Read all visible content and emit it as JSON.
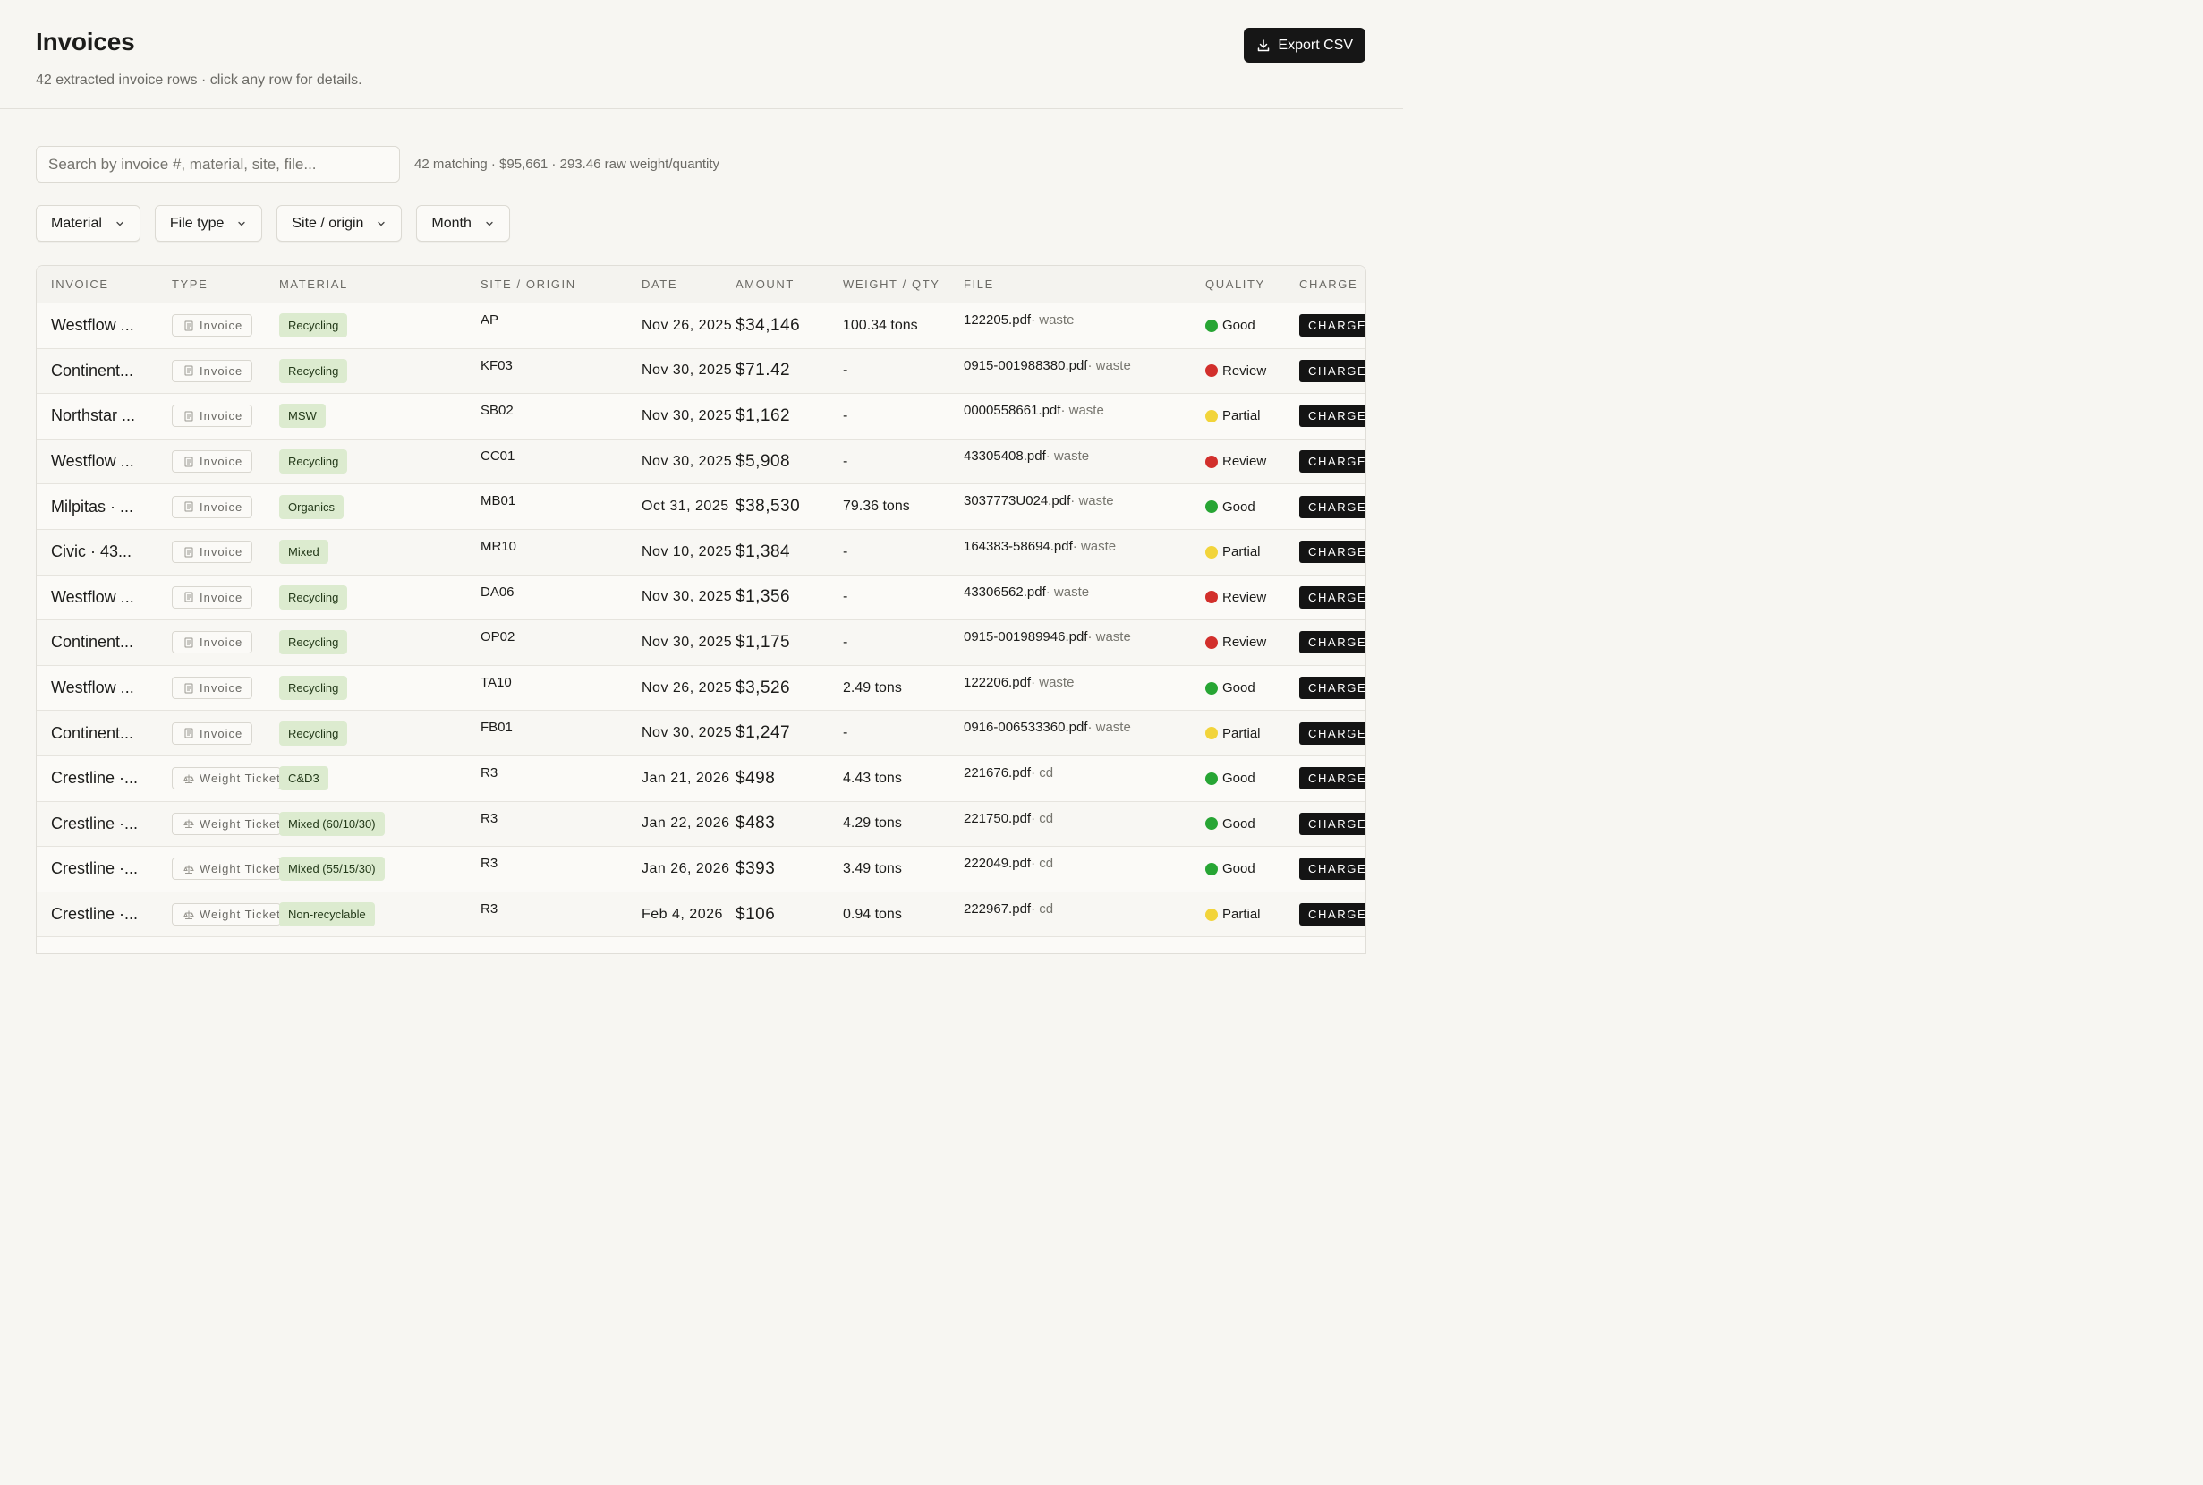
{
  "header": {
    "title": "Invoices",
    "subtitle": "42 extracted invoice rows · click any row for details.",
    "export_label": "Export CSV"
  },
  "search": {
    "placeholder": "Search by invoice #, material, site, file...",
    "summary": "42 matching · $95,661 · 293.46 raw weight/quantity"
  },
  "filters": [
    "Material",
    "File type",
    "Site / origin",
    "Month"
  ],
  "columns": {
    "invoice": "Invoice",
    "type": "Type",
    "material": "Material",
    "site": "Site / origin",
    "date": "Date",
    "amount": "Amount",
    "weight": "Weight / qty",
    "file": "File",
    "quality": "Quality",
    "charge": "Charge"
  },
  "colors": {
    "good": "#27a534",
    "review": "#d22f2b",
    "partial": "#f2d43a",
    "material_bg": "#dcebcf",
    "charge_bg": "#141414"
  },
  "rows": [
    {
      "invoice": "Westflow ...",
      "type": "Invoice",
      "type_icon": "document-icon",
      "material": "Recycling",
      "site": "AP",
      "date": "Nov 26, 2025",
      "amount": "$34,146",
      "weight": "100.34 tons",
      "file": "122205.pdf",
      "file_kind": " · waste",
      "quality": "Good",
      "charge": "CHARGED"
    },
    {
      "invoice": "Continent...",
      "type": "Invoice",
      "type_icon": "document-icon",
      "material": "Recycling",
      "site": "KF03",
      "date": "Nov 30, 2025",
      "amount": "$71.42",
      "weight": "-",
      "file": "0915-001988380.pdf",
      "file_kind": " · waste",
      "quality": "Review",
      "charge": "CHARGED"
    },
    {
      "invoice": "Northstar ...",
      "type": "Invoice",
      "type_icon": "document-icon",
      "material": "MSW",
      "site": "SB02",
      "date": "Nov 30, 2025",
      "amount": "$1,162",
      "weight": "-",
      "file": "0000558661.pdf",
      "file_kind": " · waste",
      "quality": "Partial",
      "charge": "CHARGED"
    },
    {
      "invoice": "Westflow ...",
      "type": "Invoice",
      "type_icon": "document-icon",
      "material": "Recycling",
      "site": "CC01",
      "date": "Nov 30, 2025",
      "amount": "$5,908",
      "weight": "-",
      "file": "43305408.pdf",
      "file_kind": " · waste",
      "quality": "Review",
      "charge": "CHARGED"
    },
    {
      "invoice": "Milpitas · ...",
      "type": "Invoice",
      "type_icon": "document-icon",
      "material": "Organics",
      "site": "MB01",
      "date": "Oct 31, 2025",
      "amount": "$38,530",
      "weight": "79.36 tons",
      "file": "3037773U024.pdf",
      "file_kind": " · waste",
      "quality": "Good",
      "charge": "CHARGED"
    },
    {
      "invoice": "Civic · 43...",
      "type": "Invoice",
      "type_icon": "document-icon",
      "material": "Mixed",
      "site": "MR10",
      "date": "Nov 10, 2025",
      "amount": "$1,384",
      "weight": "-",
      "file": "164383-58694.pdf",
      "file_kind": " · waste",
      "quality": "Partial",
      "charge": "CHARGED"
    },
    {
      "invoice": "Westflow ...",
      "type": "Invoice",
      "type_icon": "document-icon",
      "material": "Recycling",
      "site": "DA06",
      "date": "Nov 30, 2025",
      "amount": "$1,356",
      "weight": "-",
      "file": "43306562.pdf",
      "file_kind": " · waste",
      "quality": "Review",
      "charge": "CHARGED"
    },
    {
      "invoice": "Continent...",
      "type": "Invoice",
      "type_icon": "document-icon",
      "material": "Recycling",
      "site": "OP02",
      "date": "Nov 30, 2025",
      "amount": "$1,175",
      "weight": "-",
      "file": "0915-001989946.pdf",
      "file_kind": " · waste",
      "quality": "Review",
      "charge": "CHARGED"
    },
    {
      "invoice": "Westflow ...",
      "type": "Invoice",
      "type_icon": "document-icon",
      "material": "Recycling",
      "site": "TA10",
      "date": "Nov 26, 2025",
      "amount": "$3,526",
      "weight": "2.49 tons",
      "file": "122206.pdf",
      "file_kind": " · waste",
      "quality": "Good",
      "charge": "CHARGED"
    },
    {
      "invoice": "Continent...",
      "type": "Invoice",
      "type_icon": "document-icon",
      "material": "Recycling",
      "site": "FB01",
      "date": "Nov 30, 2025",
      "amount": "$1,247",
      "weight": "-",
      "file": "0916-006533360.pdf",
      "file_kind": " · waste",
      "quality": "Partial",
      "charge": "CHARGED"
    },
    {
      "invoice": "Crestline ·...",
      "type": "Weight Ticket",
      "type_icon": "scale-icon",
      "material": "C&D3",
      "site": "R3",
      "date": "Jan 21, 2026",
      "amount": "$498",
      "weight": "4.43 tons",
      "file": "221676.pdf",
      "file_kind": " · cd",
      "quality": "Good",
      "charge": "CHARGED"
    },
    {
      "invoice": "Crestline ·...",
      "type": "Weight Ticket",
      "type_icon": "scale-icon",
      "material": "Mixed (60/10/30)",
      "site": "R3",
      "date": "Jan 22, 2026",
      "amount": "$483",
      "weight": "4.29 tons",
      "file": "221750.pdf",
      "file_kind": " · cd",
      "quality": "Good",
      "charge": "CHARGED"
    },
    {
      "invoice": "Crestline ·...",
      "type": "Weight Ticket",
      "type_icon": "scale-icon",
      "material": "Mixed (55/15/30)",
      "site": "R3",
      "date": "Jan 26, 2026",
      "amount": "$393",
      "weight": "3.49 tons",
      "file": "222049.pdf",
      "file_kind": " · cd",
      "quality": "Good",
      "charge": "CHARGED"
    },
    {
      "invoice": "Crestline ·...",
      "type": "Weight Ticket",
      "type_icon": "scale-icon",
      "material": "Non-recyclable",
      "site": "R3",
      "date": "Feb 4, 2026",
      "amount": "$106",
      "weight": "0.94 tons",
      "file": "222967.pdf",
      "file_kind": " · cd",
      "quality": "Partial",
      "charge": "CHARGED"
    }
  ]
}
